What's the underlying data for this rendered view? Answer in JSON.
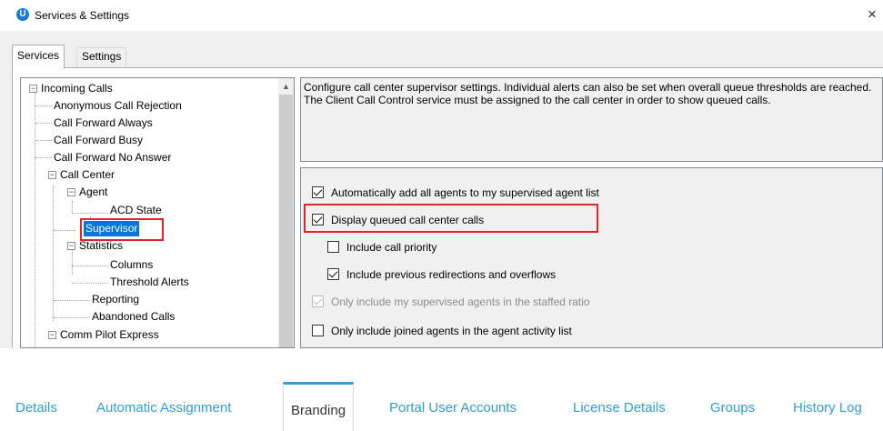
{
  "dialog": {
    "title": "Services & Settings",
    "app_icon_letter": "U",
    "close_glyph": "×",
    "tabs": [
      {
        "label": "Services",
        "active": true
      },
      {
        "label": "Settings",
        "active": false
      }
    ]
  },
  "tree": {
    "nodes": [
      {
        "label": "Incoming Calls",
        "toggle": "−"
      },
      {
        "label": "Anonymous Call Rejection"
      },
      {
        "label": "Call Forward Always"
      },
      {
        "label": "Call Forward Busy"
      },
      {
        "label": "Call Forward No Answer"
      },
      {
        "label": "Call Center",
        "toggle": "−"
      },
      {
        "label": "Agent",
        "toggle": "−"
      },
      {
        "label": "ACD State"
      },
      {
        "label": "Supervisor",
        "selected": true
      },
      {
        "label": "Statistics",
        "toggle": "−"
      },
      {
        "label": "Columns"
      },
      {
        "label": "Threshold Alerts"
      },
      {
        "label": "Reporting"
      },
      {
        "label": "Abandoned Calls"
      },
      {
        "label": "Comm Pilot Express",
        "toggle": "−"
      }
    ],
    "scroll_up_glyph": "▲"
  },
  "description": "Configure call center supervisor settings.  Individual alerts can also be set when overall queue thresholds are reached.  The Client Call Control service must be assigned to the call center in order to show queued calls.",
  "options": [
    {
      "label": "Automatically add all agents to my supervised agent list",
      "checked": true,
      "disabled": false
    },
    {
      "label": "Display queued call center calls",
      "checked": true,
      "disabled": false
    },
    {
      "label": "Include call priority",
      "checked": false,
      "disabled": false
    },
    {
      "label": "Include previous redirections and overflows",
      "checked": true,
      "disabled": false
    },
    {
      "label": "Only include my supervised agents in the staffed ratio",
      "checked": true,
      "disabled": true
    },
    {
      "label": "Only include joined agents in the agent activity list",
      "checked": false,
      "disabled": false
    }
  ],
  "bottom_tabs": [
    {
      "label": "Details",
      "active": false
    },
    {
      "label": "Automatic Assignment",
      "active": false
    },
    {
      "label": "Branding",
      "active": true
    },
    {
      "label": "Portal User Accounts",
      "active": false
    },
    {
      "label": "License Details",
      "active": false
    },
    {
      "label": "Groups",
      "active": false
    },
    {
      "label": "History Log",
      "active": false
    }
  ],
  "colors": {
    "highlight_box": "#e0242b",
    "selection": "#0078d7",
    "tab_accent": "#2e9fd9",
    "app_icon": "#1b7bd4"
  }
}
